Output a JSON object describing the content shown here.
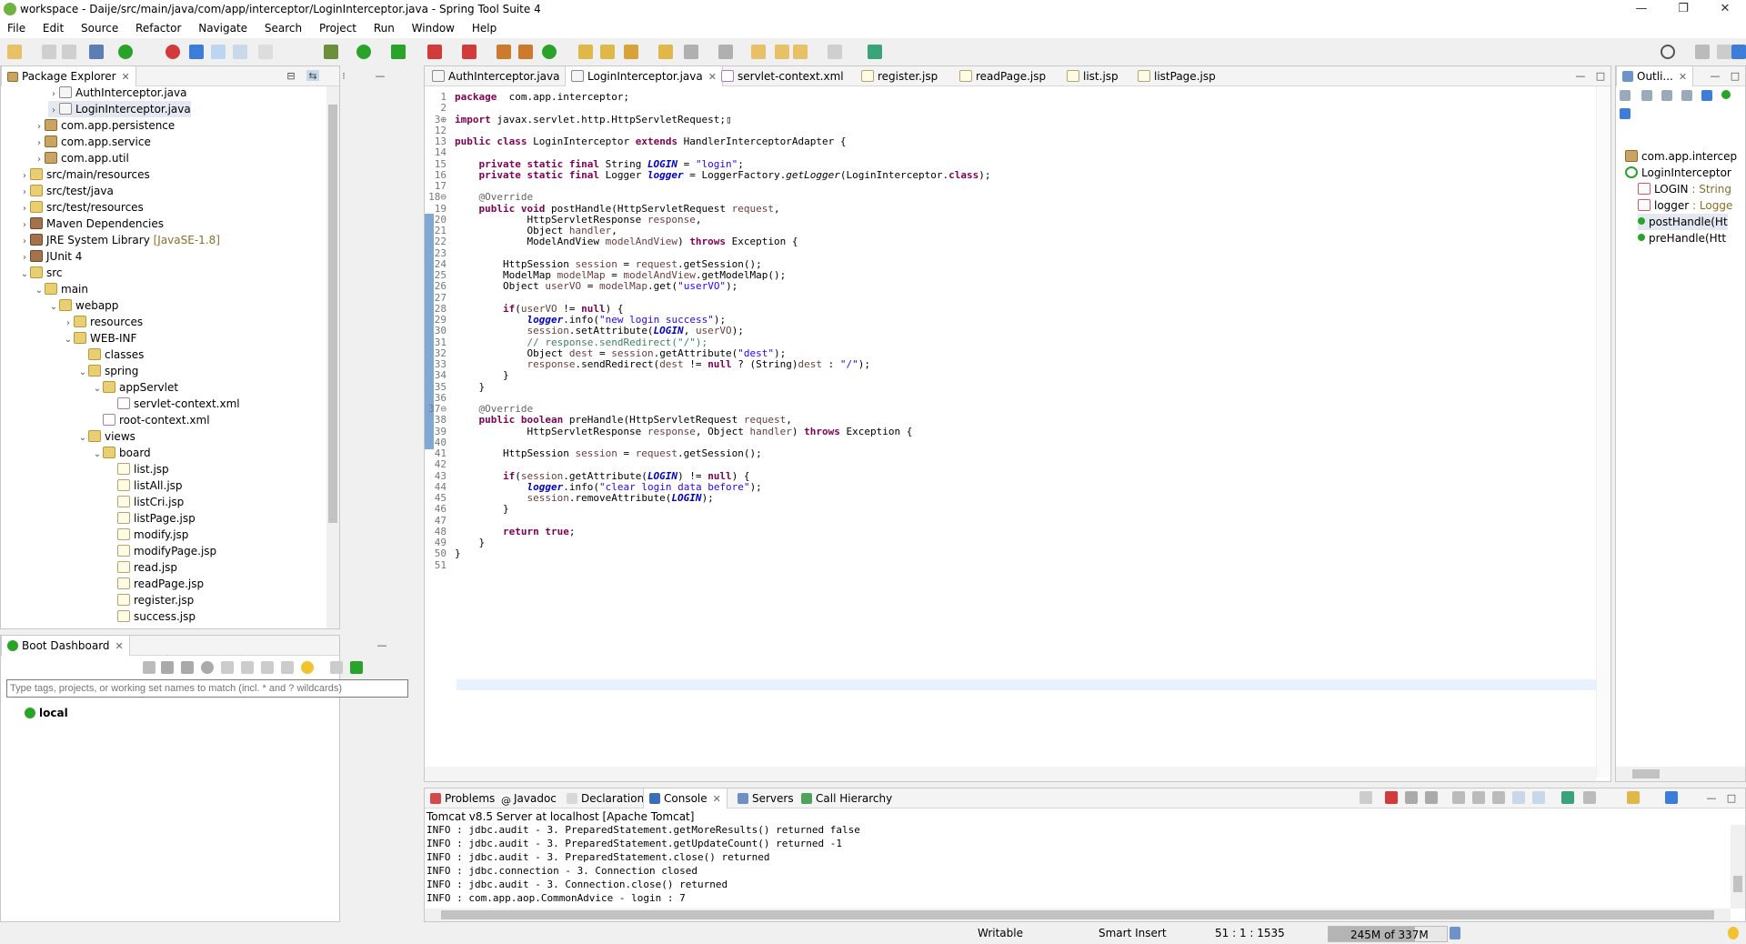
{
  "window": {
    "title": "workspace - Daije/src/main/java/com/app/interceptor/LoginInterceptor.java - Spring Tool Suite 4",
    "minimize": "—",
    "maximize": "❐",
    "close": "✕"
  },
  "menu": [
    "File",
    "Edit",
    "Source",
    "Refactor",
    "Navigate",
    "Search",
    "Project",
    "Run",
    "Window",
    "Help"
  ],
  "package_explorer": {
    "title": "Package Explorer",
    "tree": [
      {
        "label": "AuthInterceptor.java",
        "icon": "java-file-icon",
        "indent": 4,
        "twisty": ">"
      },
      {
        "label": "LoginInterceptor.java",
        "icon": "java-file-icon",
        "indent": 4,
        "twisty": ">",
        "selected": true
      },
      {
        "label": "com.app.persistence",
        "icon": "package-icon",
        "indent": 3,
        "twisty": ">"
      },
      {
        "label": "com.app.service",
        "icon": "package-icon",
        "indent": 3,
        "twisty": ">"
      },
      {
        "label": "com.app.util",
        "icon": "package-icon",
        "indent": 3,
        "twisty": ">"
      },
      {
        "label": "src/main/resources",
        "icon": "source-folder-icon",
        "indent": 2,
        "twisty": ">"
      },
      {
        "label": "src/test/java",
        "icon": "source-folder-icon",
        "indent": 2,
        "twisty": ">"
      },
      {
        "label": "src/test/resources",
        "icon": "source-folder-icon",
        "indent": 2,
        "twisty": ">"
      },
      {
        "label": "Maven Dependencies",
        "icon": "library-icon",
        "indent": 2,
        "twisty": ">"
      },
      {
        "label": "JRE System Library",
        "suffix": "[JavaSE-1.8]",
        "icon": "library-icon",
        "indent": 2,
        "twisty": ">"
      },
      {
        "label": "JUnit 4",
        "icon": "library-icon",
        "indent": 2,
        "twisty": ">"
      },
      {
        "label": "src",
        "icon": "folder-icon",
        "indent": 2,
        "twisty": "v"
      },
      {
        "label": "main",
        "icon": "folder-icon",
        "indent": 3,
        "twisty": "v"
      },
      {
        "label": "webapp",
        "icon": "folder-icon",
        "indent": 4,
        "twisty": "v"
      },
      {
        "label": "resources",
        "icon": "folder-icon",
        "indent": 5,
        "twisty": ">"
      },
      {
        "label": "WEB-INF",
        "icon": "folder-icon",
        "indent": 5,
        "twisty": "v"
      },
      {
        "label": "classes",
        "icon": "folder-icon",
        "indent": 6,
        "twisty": ""
      },
      {
        "label": "spring",
        "icon": "folder-icon",
        "indent": 6,
        "twisty": "v"
      },
      {
        "label": "appServlet",
        "icon": "folder-icon",
        "indent": 7,
        "twisty": "v"
      },
      {
        "label": "servlet-context.xml",
        "icon": "xml-file-icon",
        "indent": 8,
        "twisty": ""
      },
      {
        "label": "root-context.xml",
        "icon": "xml-file-icon",
        "indent": 7,
        "twisty": ""
      },
      {
        "label": "views",
        "icon": "folder-icon",
        "indent": 6,
        "twisty": "v"
      },
      {
        "label": "board",
        "icon": "folder-icon",
        "indent": 7,
        "twisty": "v"
      },
      {
        "label": "list.jsp",
        "icon": "jsp-file-icon",
        "indent": 8,
        "twisty": ""
      },
      {
        "label": "listAll.jsp",
        "icon": "jsp-file-icon",
        "indent": 8,
        "twisty": ""
      },
      {
        "label": "listCri.jsp",
        "icon": "jsp-file-icon",
        "indent": 8,
        "twisty": ""
      },
      {
        "label": "listPage.jsp",
        "icon": "jsp-file-icon",
        "indent": 8,
        "twisty": ""
      },
      {
        "label": "modify.jsp",
        "icon": "jsp-file-icon",
        "indent": 8,
        "twisty": ""
      },
      {
        "label": "modifyPage.jsp",
        "icon": "jsp-file-icon",
        "indent": 8,
        "twisty": ""
      },
      {
        "label": "read.jsp",
        "icon": "jsp-file-icon",
        "indent": 8,
        "twisty": ""
      },
      {
        "label": "readPage.jsp",
        "icon": "jsp-file-icon",
        "indent": 8,
        "twisty": ""
      },
      {
        "label": "register.jsp",
        "icon": "jsp-file-icon",
        "indent": 8,
        "twisty": ""
      },
      {
        "label": "success.jsp",
        "icon": "jsp-file-icon",
        "indent": 8,
        "twisty": ""
      }
    ]
  },
  "boot_dashboard": {
    "title": "Boot Dashboard",
    "filter_placeholder": "Type tags, projects, or working set names to match (incl. * and ? wildcards)",
    "items": [
      "local"
    ]
  },
  "editor": {
    "tabs": [
      "AuthInterceptor.java",
      "LoginInterceptor.java",
      "servlet-context.xml",
      "register.jsp",
      "readPage.jsp",
      "list.jsp",
      "listPage.jsp"
    ],
    "active_tab": "LoginInterceptor.java",
    "lines": [
      {
        "n": "1",
        "tokens": [
          [
            "kw",
            "package"
          ],
          [
            "",
            "  com.app.interceptor;"
          ]
        ]
      },
      {
        "n": "2",
        "tokens": []
      },
      {
        "n": "3⊕",
        "tokens": [
          [
            "kw",
            "import"
          ],
          [
            "",
            " javax.servlet.http.HttpServletRequest;▯"
          ]
        ]
      },
      {
        "n": "12",
        "tokens": []
      },
      {
        "n": "13",
        "tokens": [
          [
            "kw",
            "public class"
          ],
          [
            "",
            " LoginInterceptor "
          ],
          [
            "kw",
            "extends"
          ],
          [
            "",
            " HandlerInterceptorAdapter {"
          ]
        ]
      },
      {
        "n": "14",
        "tokens": []
      },
      {
        "n": "15",
        "tokens": [
          [
            "",
            "    "
          ],
          [
            "kw",
            "private static final"
          ],
          [
            "",
            " String "
          ],
          [
            "fldi",
            "LOGIN"
          ],
          [
            "",
            " = "
          ],
          [
            "st",
            "\"login\""
          ],
          [
            "",
            ";"
          ]
        ]
      },
      {
        "n": "16",
        "tokens": [
          [
            "",
            "    "
          ],
          [
            "kw",
            "private static final"
          ],
          [
            "",
            " Logger "
          ],
          [
            "fldi",
            "logger"
          ],
          [
            "",
            " = LoggerFactory."
          ],
          [
            "sm",
            "getLogger"
          ],
          [
            "",
            "(LoginInterceptor."
          ],
          [
            "kw",
            "class"
          ],
          [
            "",
            ");"
          ]
        ]
      },
      {
        "n": "17",
        "tokens": []
      },
      {
        "n": "18⊖",
        "tokens": [
          [
            "",
            "    "
          ],
          [
            "ann",
            "@Override"
          ]
        ]
      },
      {
        "n": "19",
        "tokens": [
          [
            "",
            "    "
          ],
          [
            "kw",
            "public void"
          ],
          [
            "",
            " postHandle(HttpServletRequest "
          ],
          [
            "var",
            "request"
          ],
          [
            "",
            ","
          ]
        ]
      },
      {
        "n": "20",
        "tokens": [
          [
            "",
            "            HttpServletResponse "
          ],
          [
            "var",
            "response"
          ],
          [
            "",
            ","
          ]
        ]
      },
      {
        "n": "21",
        "tokens": [
          [
            "",
            "            Object "
          ],
          [
            "var",
            "handler"
          ],
          [
            "",
            ","
          ]
        ]
      },
      {
        "n": "22",
        "tokens": [
          [
            "",
            "            ModelAndView "
          ],
          [
            "var",
            "modelAndView"
          ],
          [
            "",
            ") "
          ],
          [
            "kw",
            "throws"
          ],
          [
            "",
            " Exception {"
          ]
        ]
      },
      {
        "n": "23",
        "tokens": []
      },
      {
        "n": "24",
        "tokens": [
          [
            "",
            "        HttpSession "
          ],
          [
            "var",
            "session"
          ],
          [
            "",
            " = "
          ],
          [
            "var",
            "request"
          ],
          [
            "",
            ".getSession();"
          ]
        ]
      },
      {
        "n": "25",
        "tokens": [
          [
            "",
            "        ModelMap "
          ],
          [
            "var",
            "modelMap"
          ],
          [
            "",
            " = "
          ],
          [
            "var",
            "modelAndView"
          ],
          [
            "",
            ".getModelMap();"
          ]
        ]
      },
      {
        "n": "26",
        "tokens": [
          [
            "",
            "        Object "
          ],
          [
            "var",
            "userVO"
          ],
          [
            "",
            " = "
          ],
          [
            "var",
            "modelMap"
          ],
          [
            "",
            ".get("
          ],
          [
            "st",
            "\"userVO\""
          ],
          [
            "",
            ");"
          ]
        ]
      },
      {
        "n": "27",
        "tokens": []
      },
      {
        "n": "28",
        "tokens": [
          [
            "",
            "        "
          ],
          [
            "kw",
            "if"
          ],
          [
            "",
            "("
          ],
          [
            "var",
            "userVO"
          ],
          [
            "",
            " != "
          ],
          [
            "kw",
            "null"
          ],
          [
            "",
            ") {"
          ]
        ]
      },
      {
        "n": "29",
        "tokens": [
          [
            "",
            "            "
          ],
          [
            "fldi",
            "logger"
          ],
          [
            "",
            ".info("
          ],
          [
            "st",
            "\"new login success\""
          ],
          [
            "",
            ");"
          ]
        ]
      },
      {
        "n": "30",
        "tokens": [
          [
            "",
            "            "
          ],
          [
            "var",
            "session"
          ],
          [
            "",
            ".setAttribute("
          ],
          [
            "fldi",
            "LOGIN"
          ],
          [
            "",
            ", "
          ],
          [
            "var",
            "userVO"
          ],
          [
            "",
            ");"
          ]
        ]
      },
      {
        "n": "31",
        "tokens": [
          [
            "",
            "            "
          ],
          [
            "cm",
            "// response.sendRedirect(\"/\");"
          ]
        ]
      },
      {
        "n": "32",
        "tokens": [
          [
            "",
            "            Object "
          ],
          [
            "var",
            "dest"
          ],
          [
            "",
            " = "
          ],
          [
            "var",
            "session"
          ],
          [
            "",
            ".getAttribute("
          ],
          [
            "st",
            "\"dest\""
          ],
          [
            "",
            ");"
          ]
        ]
      },
      {
        "n": "33",
        "tokens": [
          [
            "",
            "            "
          ],
          [
            "var",
            "response"
          ],
          [
            "",
            ".sendRedirect("
          ],
          [
            "var",
            "dest"
          ],
          [
            "",
            " != "
          ],
          [
            "kw",
            "null"
          ],
          [
            "",
            " ? (String)"
          ],
          [
            "var",
            "dest"
          ],
          [
            "",
            " : "
          ],
          [
            "st",
            "\"/\""
          ],
          [
            "",
            ");"
          ]
        ]
      },
      {
        "n": "34",
        "tokens": [
          [
            "",
            "        }"
          ]
        ]
      },
      {
        "n": "35",
        "tokens": [
          [
            "",
            "    }"
          ]
        ]
      },
      {
        "n": "36",
        "tokens": []
      },
      {
        "n": "37⊖",
        "tokens": [
          [
            "",
            "    "
          ],
          [
            "ann",
            "@Override"
          ]
        ]
      },
      {
        "n": "38",
        "tokens": [
          [
            "",
            "    "
          ],
          [
            "kw",
            "public boolean"
          ],
          [
            "",
            " preHandle(HttpServletRequest "
          ],
          [
            "var",
            "request"
          ],
          [
            "",
            ","
          ]
        ]
      },
      {
        "n": "39",
        "tokens": [
          [
            "",
            "            HttpServletResponse "
          ],
          [
            "var",
            "response"
          ],
          [
            "",
            ", Object "
          ],
          [
            "var",
            "handler"
          ],
          [
            "",
            ") "
          ],
          [
            "kw",
            "throws"
          ],
          [
            "",
            " Exception {"
          ]
        ]
      },
      {
        "n": "40",
        "tokens": []
      },
      {
        "n": "41",
        "tokens": [
          [
            "",
            "        HttpSession "
          ],
          [
            "var",
            "session"
          ],
          [
            "",
            " = "
          ],
          [
            "var",
            "request"
          ],
          [
            "",
            ".getSession();"
          ]
        ]
      },
      {
        "n": "42",
        "tokens": []
      },
      {
        "n": "43",
        "tokens": [
          [
            "",
            "        "
          ],
          [
            "kw",
            "if"
          ],
          [
            "",
            "("
          ],
          [
            "var",
            "session"
          ],
          [
            "",
            ".getAttribute("
          ],
          [
            "fldi",
            "LOGIN"
          ],
          [
            "",
            ") != "
          ],
          [
            "kw",
            "null"
          ],
          [
            "",
            ") {"
          ]
        ]
      },
      {
        "n": "44",
        "tokens": [
          [
            "",
            "            "
          ],
          [
            "fldi",
            "logger"
          ],
          [
            "",
            ".info("
          ],
          [
            "st",
            "\"clear login data before\""
          ],
          [
            "",
            ");"
          ]
        ]
      },
      {
        "n": "45",
        "tokens": [
          [
            "",
            "            "
          ],
          [
            "var",
            "session"
          ],
          [
            "",
            ".removeAttribute("
          ],
          [
            "fldi",
            "LOGIN"
          ],
          [
            "",
            ");"
          ]
        ]
      },
      {
        "n": "46",
        "tokens": [
          [
            "",
            "        }"
          ]
        ]
      },
      {
        "n": "47",
        "tokens": []
      },
      {
        "n": "48",
        "tokens": [
          [
            "",
            "        "
          ],
          [
            "kw",
            "return true"
          ],
          [
            "",
            ";"
          ]
        ]
      },
      {
        "n": "49",
        "tokens": [
          [
            "",
            "    }"
          ]
        ]
      },
      {
        "n": "50",
        "tokens": [
          [
            "",
            "}"
          ]
        ]
      },
      {
        "n": "51",
        "tokens": []
      }
    ]
  },
  "outline": {
    "title": "Outli...",
    "items": [
      {
        "label": "com.app.intercep",
        "icon": "package-icon",
        "indent": 0
      },
      {
        "label": "LoginInterceptor",
        "icon": "class-icon",
        "indent": 0
      },
      {
        "label": "LOGIN",
        "suffix": " : String",
        "icon": "static-field-icon",
        "indent": 1
      },
      {
        "label": "logger",
        "suffix": " : Logge",
        "icon": "static-field-icon",
        "indent": 1
      },
      {
        "label": "postHandle(Ht",
        "icon": "method-icon",
        "indent": 1,
        "selected": true
      },
      {
        "label": "preHandle(Htt",
        "icon": "method-icon",
        "indent": 1
      }
    ]
  },
  "bottom": {
    "tabs": [
      "Problems",
      "Javadoc",
      "Declaration",
      "Console",
      "Servers",
      "Call Hierarchy"
    ],
    "active_tab": "Console",
    "console_header": "Tomcat v8.5 Server at localhost [Apache Tomcat]",
    "console_lines": [
      "INFO : jdbc.audit - 3. PreparedStatement.getMoreResults() returned false",
      "INFO : jdbc.audit - 3. PreparedStatement.getUpdateCount() returned -1",
      "INFO : jdbc.audit - 3. PreparedStatement.close() returned",
      "INFO : jdbc.connection - 3. Connection closed",
      "INFO : jdbc.audit - 3. Connection.close() returned",
      "INFO : com.app.aop.CommonAdvice - login : 7"
    ]
  },
  "status": {
    "writable": "Writable",
    "insert_mode": "Smart Insert",
    "position": "51 : 1 : 1535",
    "memory": "245M of 337M",
    "memory_fraction": 0.73
  },
  "colors": {
    "keyword": "#7f0055",
    "string": "#2a00ff",
    "comment": "#3f7f5f",
    "field": "#0000c0",
    "selection": "#e4e8f0",
    "current_line": "#e8f2fe"
  }
}
